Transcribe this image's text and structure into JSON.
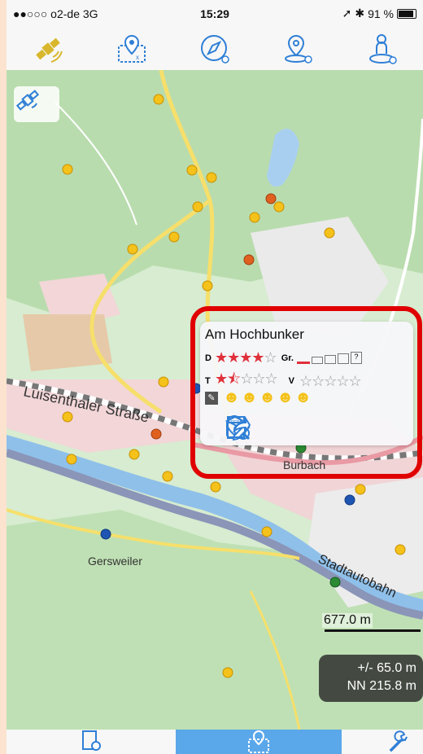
{
  "status": {
    "carrier": "●●○○○ o2-de  3G",
    "time": "15:29",
    "battery": "91 %"
  },
  "toolbar": {
    "icons": [
      "satellite-icon",
      "map-marker-icon",
      "compass-icon",
      "location-history-icon",
      "person-location-icon"
    ]
  },
  "map": {
    "labels": {
      "street1": "Luisenthaler Straße",
      "town1": "Burbach",
      "town2": "Gersweiler",
      "road": "Stadtautobahn"
    }
  },
  "popup": {
    "title": "Am Hochbunker",
    "d_label": "D",
    "t_label": "T",
    "gr_label": "Gr.",
    "v_label": "V",
    "difficulty": 4,
    "terrain": 1.5
  },
  "overlay": {
    "scale": "677.0 m",
    "accuracy": "+/- 65.0 m",
    "elevation": "NN 215.8 m"
  },
  "colors": {
    "accent": "#2f7fd6",
    "highlight": "#e00000",
    "tab_active": "#5aa7ea"
  }
}
